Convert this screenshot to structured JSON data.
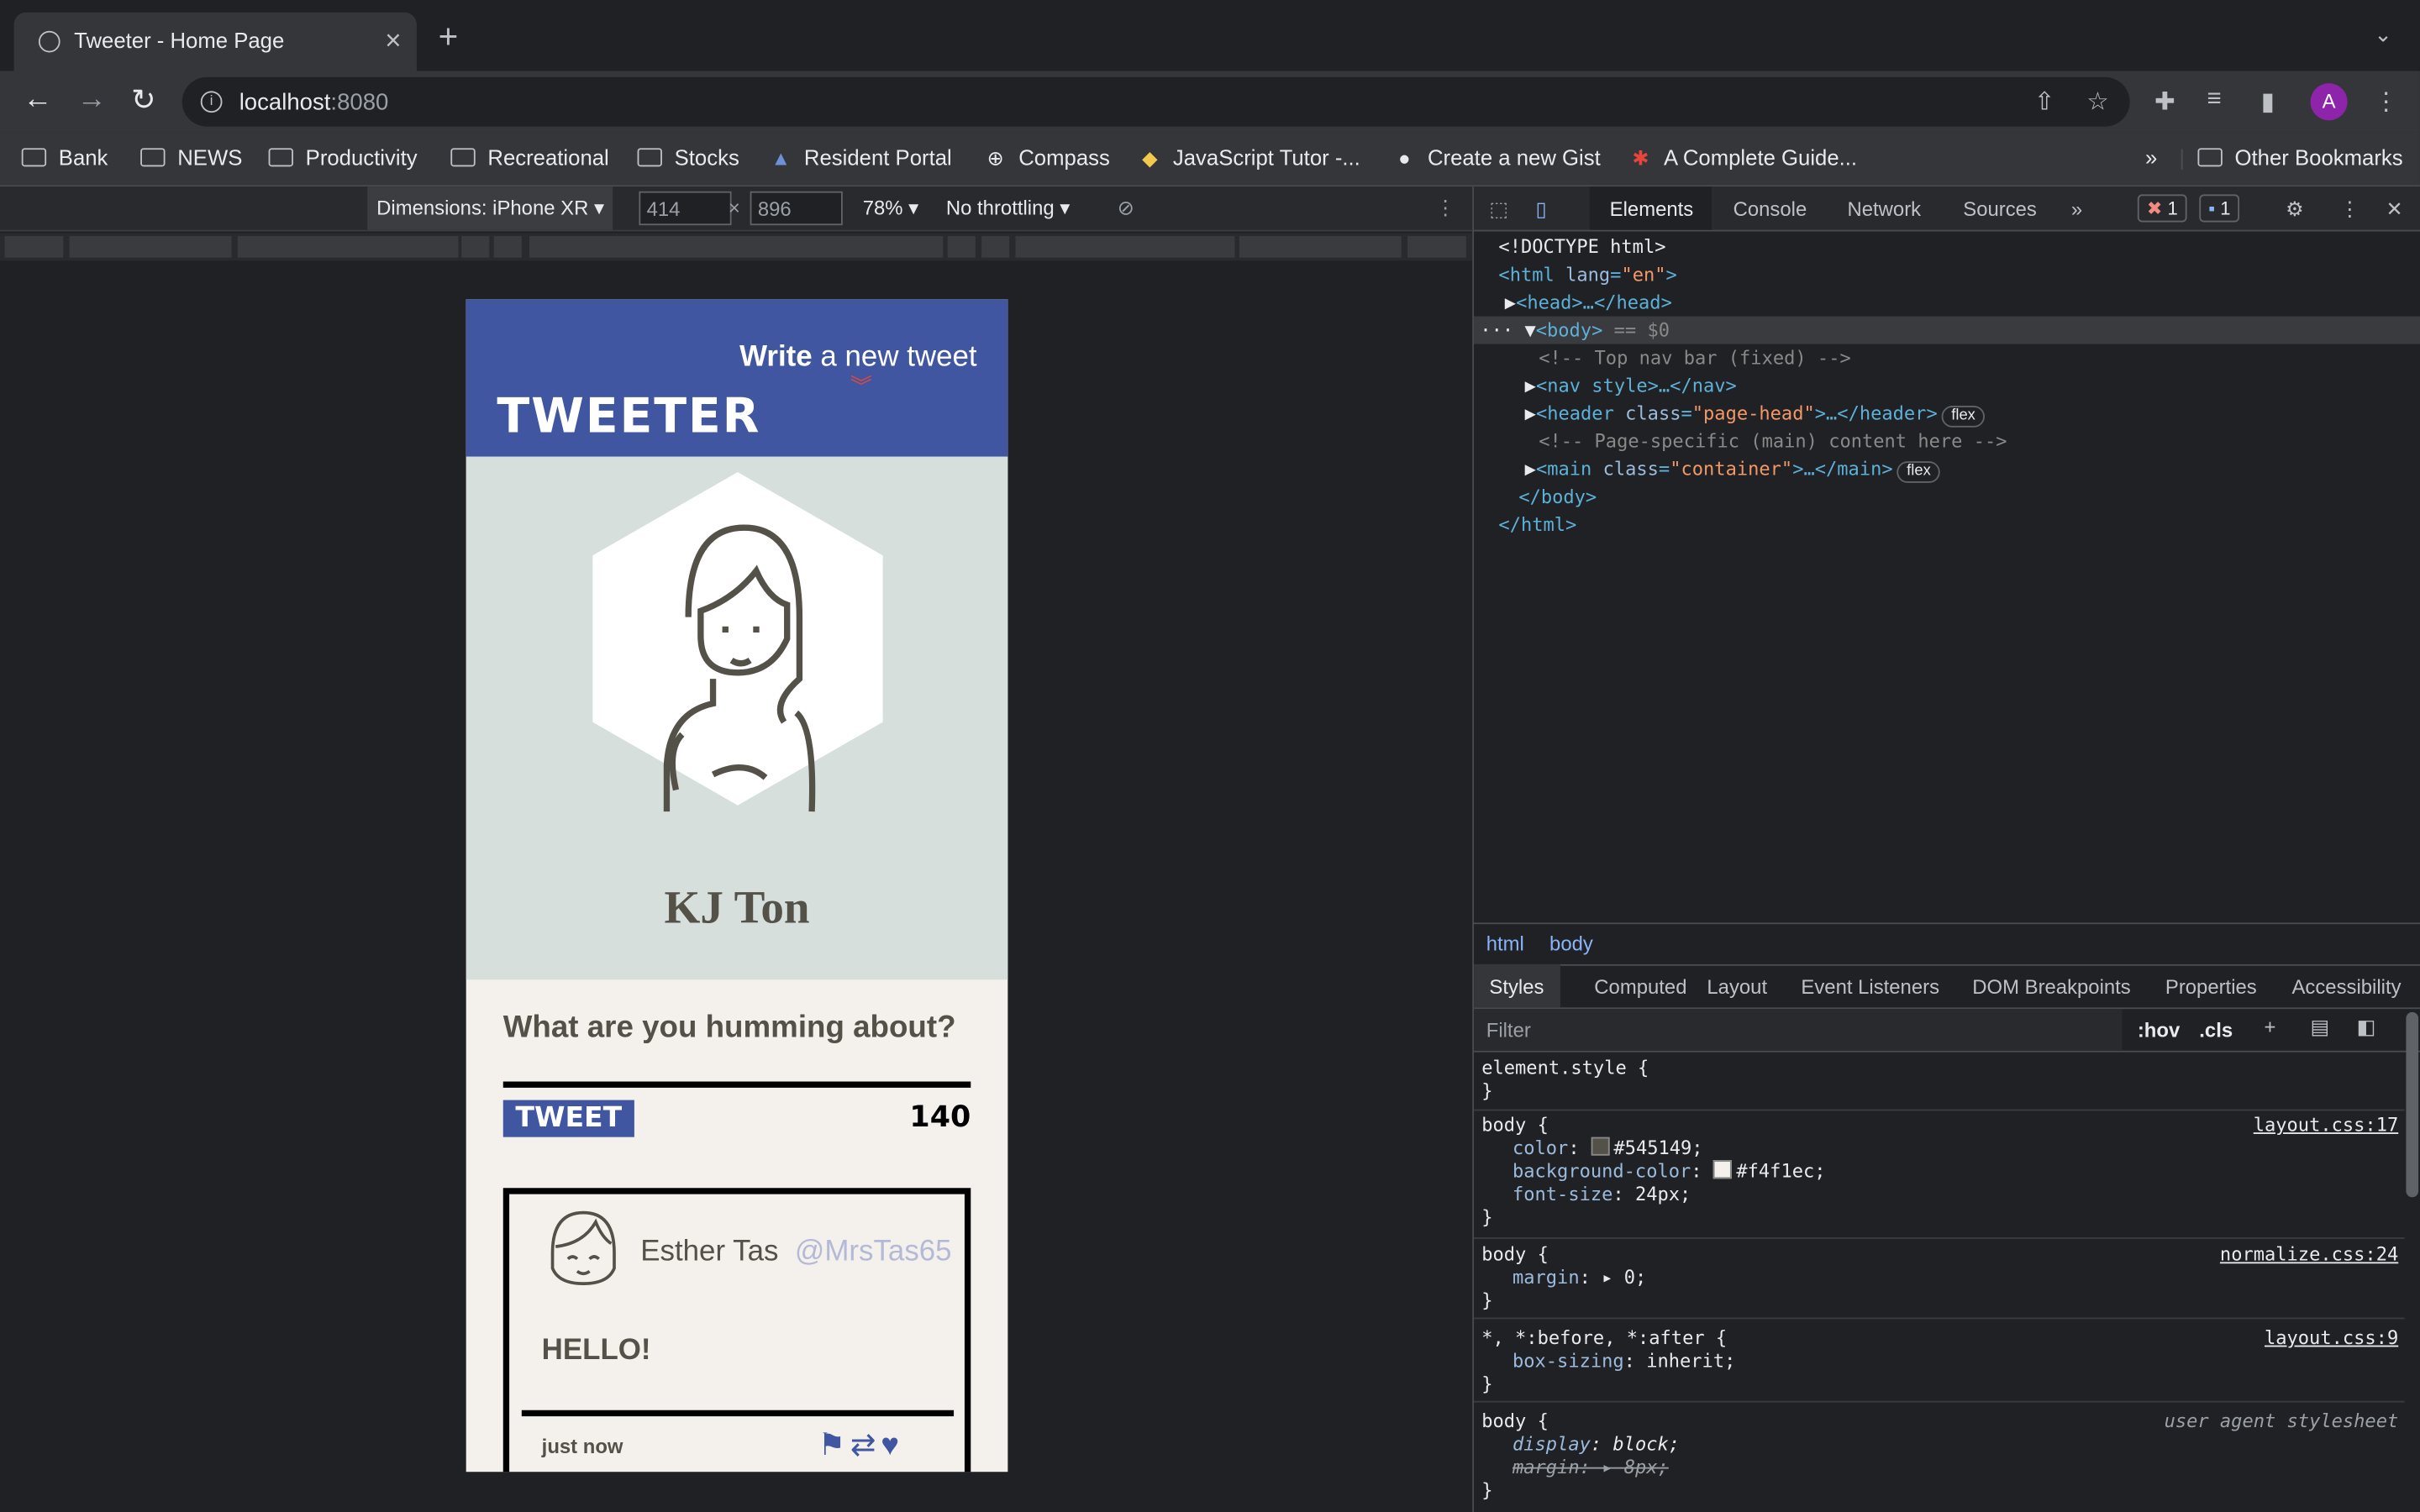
{
  "browser": {
    "tab_title": "Tweeter - Home Page",
    "url_host": "localhost",
    "url_port": ":8080",
    "bookmarks": [
      "Bank",
      "NEWS",
      "Productivity",
      "Recreational",
      "Stocks",
      "Resident Portal",
      "Compass",
      "JavaScript Tutor -...",
      "Create a new Gist",
      "A Complete Guide..."
    ],
    "more": "»",
    "other_bookmarks": "Other Bookmarks",
    "avatar_letter": "A"
  },
  "device_toolbar": {
    "dimensions": "Dimensions: iPhone XR",
    "width": "414",
    "height": "896",
    "zoom": "78%",
    "throttle": "No throttling"
  },
  "page": {
    "write_bold": "Write",
    "write_rest": " a new tweet",
    "logo": "TWEETER",
    "profile_name": "KJ Ton",
    "prompt": "What are you humming about?",
    "tweet_button": "TWEET",
    "counter": "140",
    "tweet": {
      "user": "Esther Tas",
      "handle": "@MrsTas65",
      "message": "HELLO!",
      "time": "just now"
    }
  },
  "devtools": {
    "tabs": [
      "Elements",
      "Console",
      "Network",
      "Sources"
    ],
    "errors": "1",
    "messages": "1",
    "dom": {
      "doctype": "<!DOCTYPE html>",
      "html_open": "<html",
      "lang_attr": "lang",
      "lang_val": "\"en\"",
      "head": "<head>…</head>",
      "body": "<body>",
      "body_eq": " == $0",
      "comment1": "<!-- Top nav bar (fixed) -->",
      "nav": "<nav style>…</nav>",
      "header_tag": "<header",
      "header_class": "\"page-head\"",
      "header_close": ">…</header>",
      "comment2": "<!-- Page-specific (main) content here -->",
      "main_tag": "<main",
      "main_class": "\"container\"",
      "main_close": ">…</main>",
      "body_close": "</body>",
      "html_close": "</html>",
      "flex": "flex",
      "class_attr": "class"
    },
    "breadcrumbs": [
      "html",
      "body"
    ],
    "style_tabs": [
      "Styles",
      "Computed",
      "Layout",
      "Event Listeners",
      "DOM Breakpoints",
      "Properties",
      "Accessibility"
    ],
    "filter_placeholder": "Filter",
    "hov": ":hov",
    "cls": ".cls",
    "rules": {
      "r0_sel": "element.style {",
      "r1_sel": "body {",
      "r1_src": "layout.css:17",
      "r1_p1": "color",
      "r1_v1": "#545149;",
      "r1_p2": "background-color",
      "r1_v2": "#f4f1ec;",
      "r1_p3": "font-size",
      "r1_v3": "24px;",
      "r2_sel": "body {",
      "r2_src": "normalize.css:24",
      "r2_p1": "margin",
      "r2_v1": "0;",
      "r3_sel": "*, *:before, *:after {",
      "r3_src": "layout.css:9",
      "r3_p1": "box-sizing",
      "r3_v1": "inherit;",
      "r4_sel": "body {",
      "r4_src": "user agent stylesheet",
      "r4_p1": "display",
      "r4_v1": "block;",
      "r4_p2": "margin",
      "r4_v2": "8px;",
      "close": "}"
    }
  },
  "colors": {
    "brand": "#4056a1",
    "text": "#545149",
    "bg": "#f4f1ec",
    "accent": "#e8453c"
  }
}
